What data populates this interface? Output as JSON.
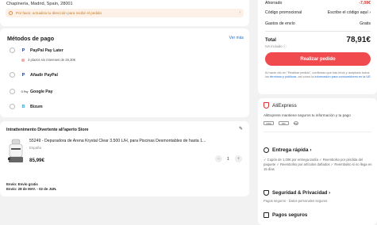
{
  "address": {
    "line": "Chapinería, Madrid, Spain, 28001",
    "warning": "Por favor, actualiza tu dirección para recibir el pedido",
    "warning_chevron": "›"
  },
  "payment": {
    "title": "Métodos de pago",
    "see_more": "Ver más",
    "methods": [
      {
        "logo": "P",
        "label": "PayPal Pay Later"
      },
      {
        "logo": "P",
        "label": "Añadir PayPal"
      },
      {
        "logo": "G Pay",
        "label": "Google Pay"
      },
      {
        "logo": "B",
        "label": "Bizum"
      }
    ],
    "paypal_later_sub": "3 plazos sin intereses de 26,30€"
  },
  "store": {
    "name": "Intrattenimento Divertente all'aperto Store",
    "edit_icon": "✎",
    "product": {
      "title": "55249 - Depuradora de Arena Krystal Clear 3.500 L/H, para Piscinas Desmontables de hasta 1...",
      "country": "España",
      "price": "85,99€",
      "quantity": "1",
      "minus": "−",
      "plus": "+"
    },
    "shipping_free": "Envío: Envío gratis",
    "shipping_date": "Envío: 28 de MAY. - 02 de JUN."
  },
  "summary": {
    "rows": [
      {
        "label": "Ahorrado",
        "value": "-7,08€"
      },
      {
        "label": "Código promocional",
        "value": "Escribe el código aquí ›"
      },
      {
        "label": "Gastos de envío",
        "value": "Gratis"
      }
    ],
    "total_label": "Total",
    "total_value": "78,91€",
    "vat_note": "IVA incluido ⓘ",
    "order_button": "Realizar pedido",
    "legal_1": "Al hacer clic en \"Realizar pedido\", confirmas que has leído y aceptado todos los ",
    "legal_link_1": "términos y políticas",
    "legal_2": ", así como la ",
    "legal_link_2": "información para consumidores en la UE."
  },
  "trust": {
    "brand": "AliExpress",
    "desc": "AliExpress mantiene seguros tu información y tu pago",
    "badges": [
      "VISA",
      "MC",
      "SSL"
    ],
    "entrega_title": "Entrega rápida  ›",
    "entrega_text": "✓ Cupón de 1,00€ por entrega tardía  ✓ Reembolso por pérdida del paquete  ✓ Reembolso por artículos dañados  ✓ Reembolso si no llega en 15 días",
    "seg_title": "Seguridad & Privacidad  ›",
    "seg_text": "Pagos seguros · Datos personales seguros",
    "pagos_title": "Pagos seguros"
  },
  "colors": {
    "accent": "#f04a4f",
    "link": "#1a6fd8",
    "warning_bg": "#fdf0e7"
  }
}
